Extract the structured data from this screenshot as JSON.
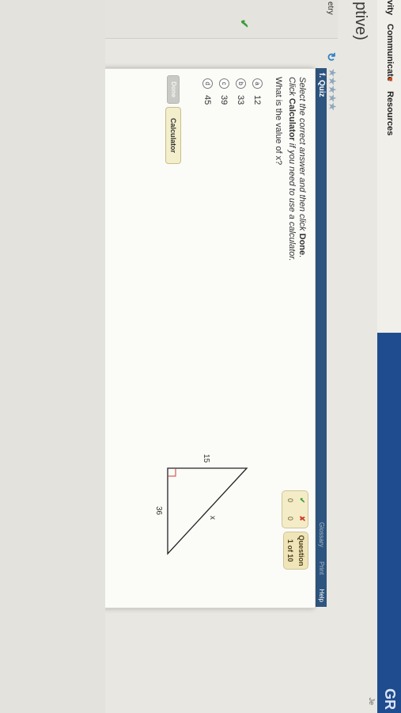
{
  "nav": {
    "item_partial": "vity",
    "communicate": "Communicate",
    "resources": "Resources",
    "brand_partial": "GR",
    "sub_partial": "Je"
  },
  "page": {
    "title_partial": "ptive)",
    "left_label_partial": "etry"
  },
  "quiz": {
    "title": "f. Quiz",
    "links": [
      "Glossary",
      "Print",
      "Help"
    ],
    "instruction_1_prefix": "Select the correct answer and then click",
    "instruction_1_bold": "Done",
    "instruction_2_prefix": "Click",
    "instruction_2_bold": "Calculator",
    "instruction_2_suffix": "if you need to use a calculator.",
    "question": "What is the value of x?",
    "options": [
      {
        "letter": "a",
        "value": "12"
      },
      {
        "letter": "b",
        "value": "33"
      },
      {
        "letter": "c",
        "value": "39"
      },
      {
        "letter": "d",
        "value": "45"
      }
    ],
    "done_label": "Done",
    "calculator_label": "Calculator"
  },
  "score": {
    "correct": "0",
    "incorrect": "0",
    "question_label": "Question",
    "question_progress": "1 of 10"
  },
  "figure": {
    "label_side": "15",
    "label_base": "36",
    "label_hyp": "x"
  },
  "colors": {
    "nav_blue": "#1f4c8f",
    "header_blue": "#2e557f",
    "correct_green": "#3a9b3a",
    "incorrect_red": "#d23b2a"
  }
}
